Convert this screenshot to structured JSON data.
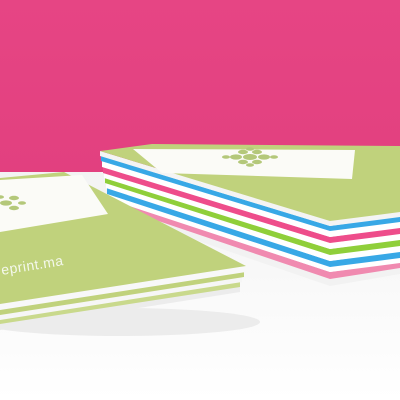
{
  "photo": {
    "colors": {
      "backdrop": "#e64584",
      "floor": "#ffffff",
      "cover_green": "#c0d27c",
      "emblem_green": "#b4c87a",
      "edge_blue": "#38a8e6",
      "edge_pink": "#ee4d8b",
      "edge_green": "#8fcf3a"
    },
    "front_stack": {
      "brand_text": "eprint.ma"
    }
  }
}
